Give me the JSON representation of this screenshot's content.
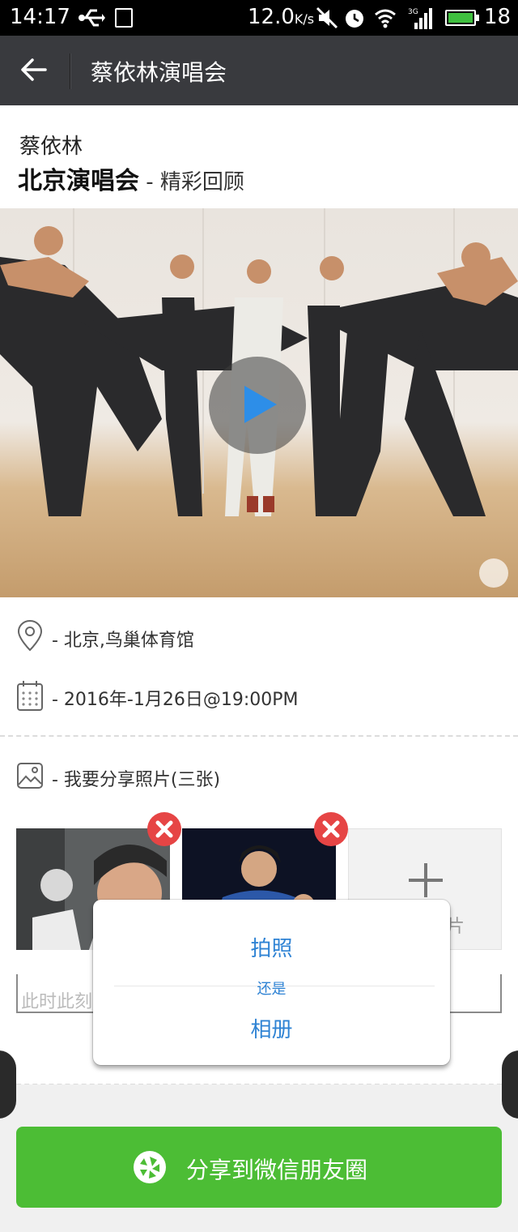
{
  "status_bar": {
    "time": "14:17",
    "speed": "12.0",
    "speed_unit": "K/s",
    "signal_tag": "3G",
    "battery_percent": "18"
  },
  "header": {
    "title": "蔡依林演唱会"
  },
  "event": {
    "artist": "蔡依林",
    "concert": "北京演唱会",
    "concert_suffix": " - 精彩回顾"
  },
  "info": {
    "location": "- 北京,鸟巢体育馆",
    "datetime": "- 2016年-1月26日@19:00PM",
    "photos": "- 我要分享照片(三张)"
  },
  "photos": {
    "add_suffix": "片"
  },
  "comment": {
    "placeholder": "此时此刻"
  },
  "popup": {
    "option_camera": "拍照",
    "divider_text": "还是",
    "option_album": "相册"
  },
  "share": {
    "label": "分享到微信朋友圈"
  },
  "colors": {
    "header": "#393a3e",
    "accent_green": "#4cbd35",
    "link_blue": "#2f83d4",
    "remove_red": "#e64545"
  }
}
